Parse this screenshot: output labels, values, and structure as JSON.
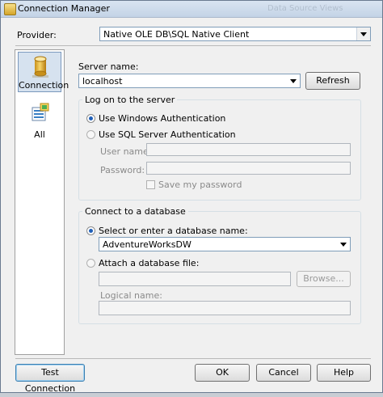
{
  "window": {
    "title": "Connection Manager",
    "ghost_tab": "Data Source Views"
  },
  "provider": {
    "label": "Provider:",
    "value": "Native OLE DB\\SQL Native Client"
  },
  "sidebar": {
    "items": [
      {
        "label": "Connection",
        "icon": "database-cylinder-icon",
        "selected": true
      },
      {
        "label": "All",
        "icon": "properties-grid-icon",
        "selected": false
      }
    ]
  },
  "server": {
    "label": "Server name:",
    "value": "localhost",
    "refresh_label": "Refresh"
  },
  "logon": {
    "title": "Log on to the server",
    "windows_auth_label": "Use Windows Authentication",
    "sql_auth_label": "Use SQL Server Authentication",
    "username_label": "User name:",
    "password_label": "Password:",
    "save_password_label": "Save my password",
    "selected": "windows"
  },
  "database": {
    "title": "Connect to a database",
    "select_label": "Select or enter a database name:",
    "db_value": "AdventureWorksDW",
    "attach_label": "Attach a database file:",
    "browse_label": "Browse...",
    "logical_name_label": "Logical name:",
    "selected": "select"
  },
  "footer": {
    "test_connection_label": "Test Connection",
    "ok_label": "OK",
    "cancel_label": "Cancel",
    "help_label": "Help"
  },
  "colors": {
    "accent": "#1f5fb8",
    "selection_bg": "#d6e2ef",
    "titlebar": "#c3d3e6"
  }
}
